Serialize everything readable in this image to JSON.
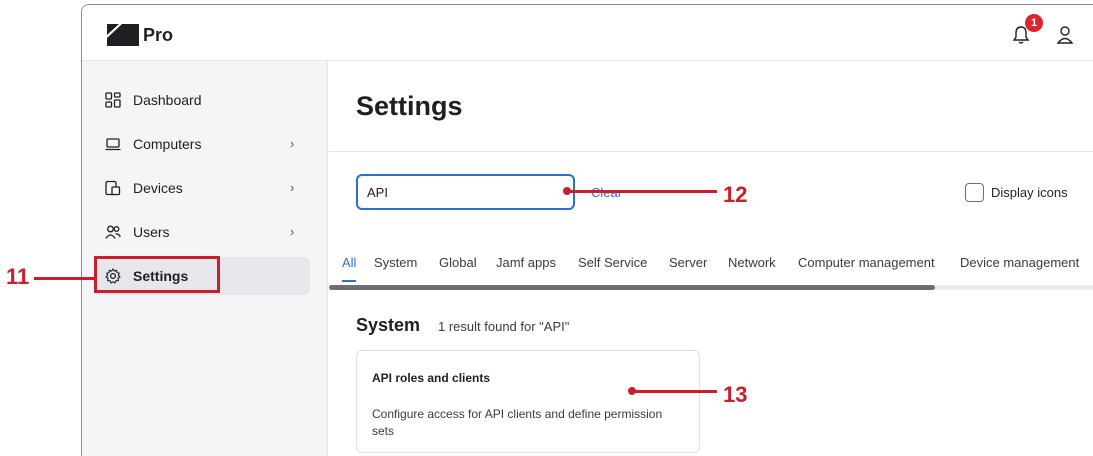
{
  "app": {
    "title": "Pro",
    "notification_count": "1"
  },
  "sidebar": {
    "items": [
      {
        "label": "Dashboard",
        "icon": "dashboard-icon",
        "chevron": ""
      },
      {
        "label": "Computers",
        "icon": "laptop-icon",
        "chevron": "›"
      },
      {
        "label": "Devices",
        "icon": "devices-icon",
        "chevron": "›"
      },
      {
        "label": "Users",
        "icon": "users-icon",
        "chevron": "›"
      },
      {
        "label": "Settings",
        "icon": "gear-icon",
        "chevron": ""
      }
    ],
    "active": "Settings"
  },
  "main": {
    "title": "Settings",
    "search": {
      "value": "API",
      "placeholder": ""
    },
    "clear_label": "Clear",
    "display_icons_label": "Display icons",
    "tabs": [
      "All",
      "System",
      "Global",
      "Jamf apps",
      "Self Service",
      "Server",
      "Network",
      "Computer management",
      "Device management"
    ],
    "active_tab": "All",
    "results": {
      "heading": "System",
      "count_text": "1 result found for \"API\"",
      "cards": [
        {
          "title": "API roles and clients",
          "description": "Configure access for API clients and define permission sets"
        }
      ]
    }
  },
  "annotations": {
    "callout_11": "11",
    "callout_12": "12",
    "callout_13": "13"
  },
  "colors": {
    "accent": "#2d6fcf",
    "callout": "#c8202a",
    "badge": "#d9252b"
  }
}
